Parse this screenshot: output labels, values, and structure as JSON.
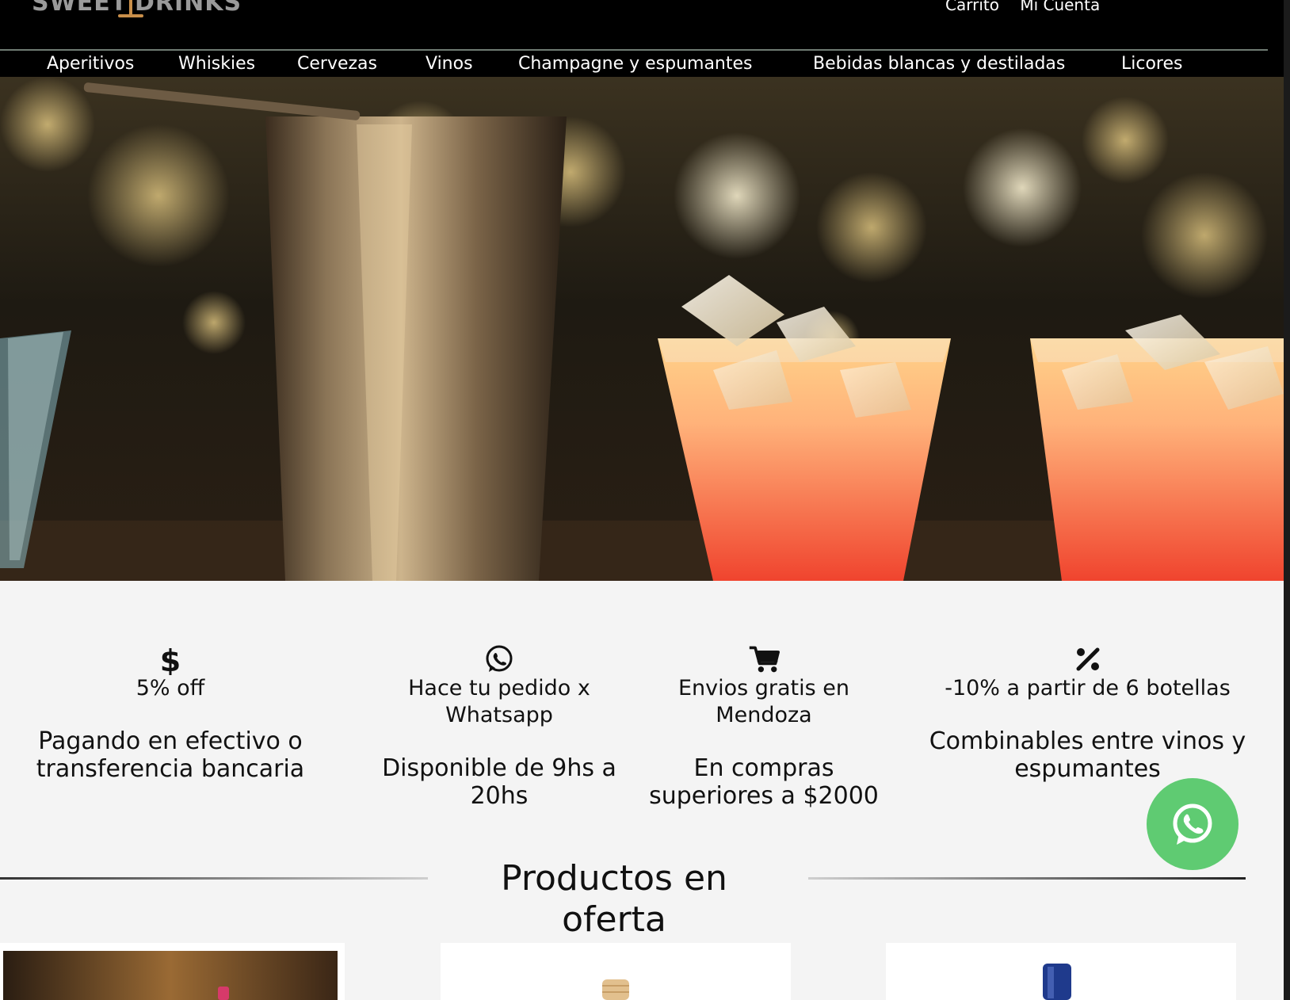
{
  "header": {
    "logo_word_1": "SWEET",
    "logo_word_2": "DRINKS",
    "links": [
      {
        "label": "Carrito"
      },
      {
        "label": "Mi Cuenta"
      }
    ]
  },
  "nav": {
    "items": [
      {
        "label": "Aperitivos"
      },
      {
        "label": "Whiskies"
      },
      {
        "label": "Cervezas"
      },
      {
        "label": "Vinos"
      },
      {
        "label": "Champagne y espumantes"
      },
      {
        "label": "Bebidas blancas y destiladas"
      },
      {
        "label": "Licores"
      }
    ]
  },
  "hero": {
    "description": "bar-cocktails-banner"
  },
  "features": [
    {
      "icon": "dollar-icon",
      "title": "5% off",
      "description": "Pagando en efectivo o transferencia bancaria"
    },
    {
      "icon": "whatsapp-icon",
      "title": "Hace tu pedido x Whatsapp",
      "description": "Disponible de 9hs a 20hs"
    },
    {
      "icon": "cart-icon",
      "title": "Envios gratis en Mendoza",
      "description": "En compras superiores a $2000"
    },
    {
      "icon": "percent-icon",
      "title": "-10% a partir de 6 botellas",
      "description": "Combinables entre vinos y espumantes"
    }
  ],
  "offers": {
    "title": "Productos en oferta"
  },
  "colors": {
    "header_bg": "#000000",
    "page_bg": "#f4f4f4",
    "whatsapp_green": "#5fcb72",
    "logo_gold": "#c98f4a"
  },
  "floating": {
    "icon": "whatsapp-icon"
  }
}
